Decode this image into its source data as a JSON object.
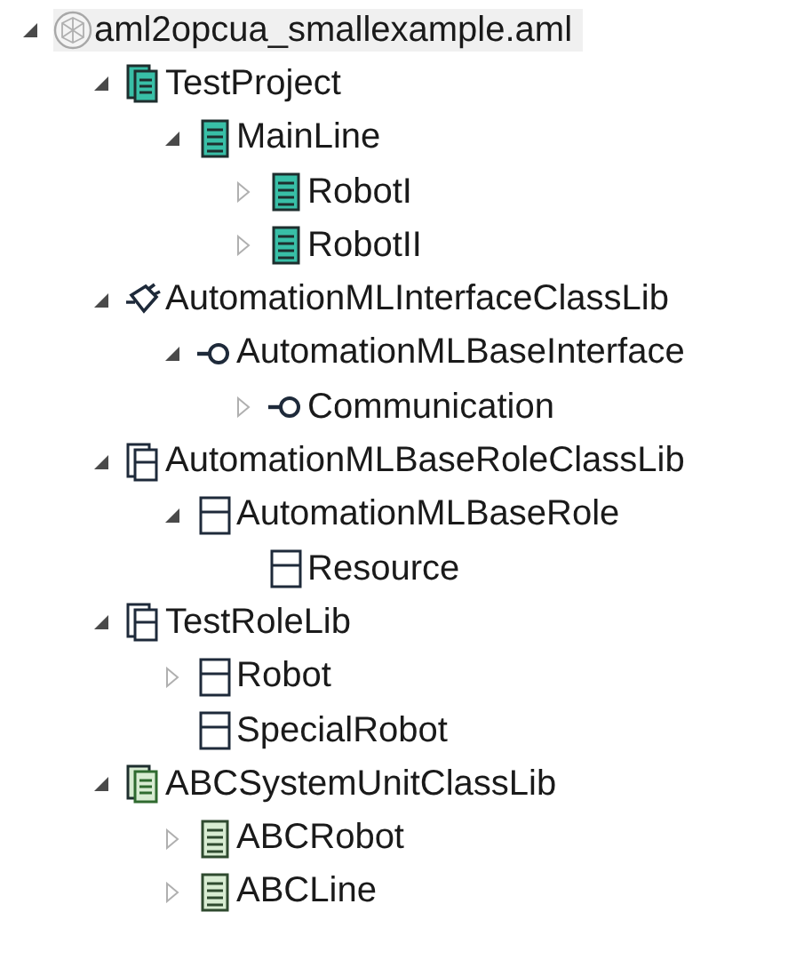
{
  "tree": [
    {
      "label": "aml2opcua_smallexample.aml",
      "kind": "file",
      "expanded": true,
      "selected": true,
      "children": [
        {
          "label": "TestProject",
          "kind": "instance-hierarchy",
          "expanded": true,
          "selected": false,
          "children": [
            {
              "label": "MainLine",
              "kind": "internal-element",
              "expanded": true,
              "selected": false,
              "children": [
                {
                  "label": "RobotI",
                  "kind": "internal-element",
                  "expanded": false,
                  "selected": false
                },
                {
                  "label": "RobotII",
                  "kind": "internal-element",
                  "expanded": false,
                  "selected": false
                }
              ]
            }
          ]
        },
        {
          "label": "AutomationMLInterfaceClassLib",
          "kind": "interface-lib",
          "expanded": true,
          "selected": false,
          "children": [
            {
              "label": "AutomationMLBaseInterface",
              "kind": "interface",
              "expanded": true,
              "selected": false,
              "children": [
                {
                  "label": "Communication",
                  "kind": "interface",
                  "expanded": false,
                  "selected": false
                }
              ]
            }
          ]
        },
        {
          "label": "AutomationMLBaseRoleClassLib",
          "kind": "role-lib",
          "expanded": true,
          "selected": false,
          "children": [
            {
              "label": "AutomationMLBaseRole",
              "kind": "role",
              "expanded": true,
              "selected": false,
              "children": [
                {
                  "label": "Resource",
                  "kind": "role",
                  "selected": false
                }
              ]
            }
          ]
        },
        {
          "label": "TestRoleLib",
          "kind": "role-lib",
          "expanded": true,
          "selected": false,
          "children": [
            {
              "label": "Robot",
              "kind": "role",
              "expanded": false,
              "selected": false
            },
            {
              "label": "SpecialRobot",
              "kind": "role",
              "selected": false
            }
          ]
        },
        {
          "label": "ABCSystemUnitClassLib",
          "kind": "system-unit-lib",
          "expanded": true,
          "selected": false,
          "children": [
            {
              "label": "ABCRobot",
              "kind": "system-unit",
              "expanded": false,
              "selected": false
            },
            {
              "label": "ABCLine",
              "kind": "system-unit",
              "expanded": false,
              "selected": false
            }
          ]
        }
      ]
    }
  ]
}
